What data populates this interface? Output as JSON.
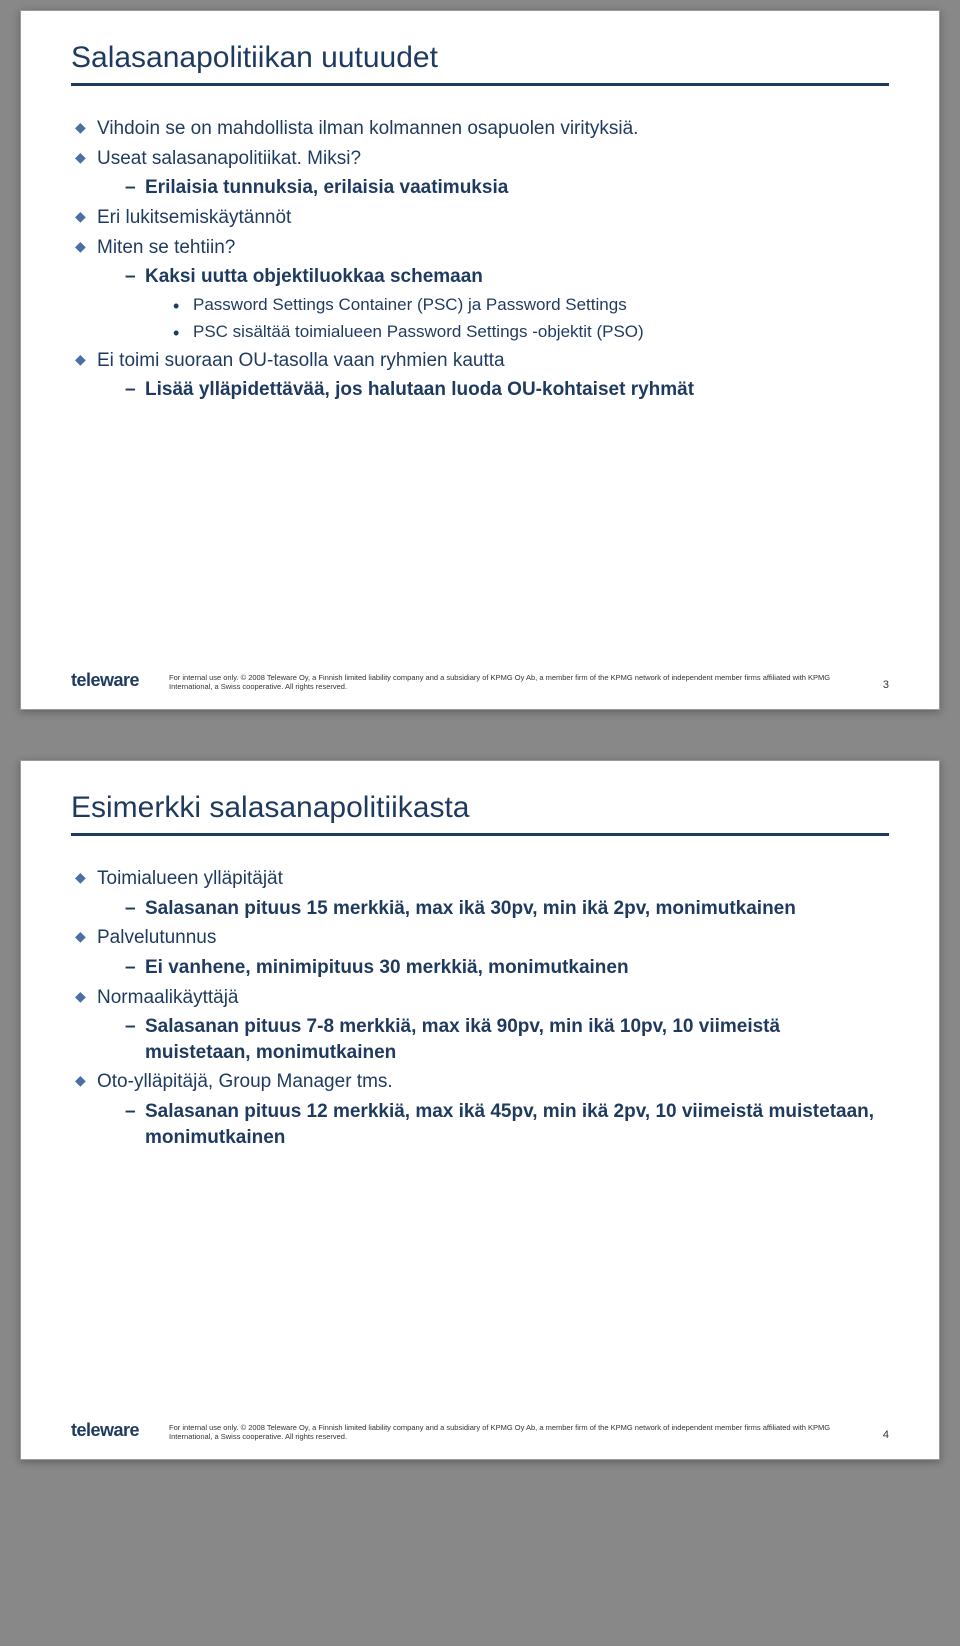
{
  "slides": [
    {
      "title": "Salasanapolitiikan uutuudet",
      "items": [
        {
          "text": "Vihdoin se on mahdollista ilman kolmannen osapuolen virityksiä."
        },
        {
          "text": "Useat salasanapolitiikat. Miksi?",
          "sub": [
            {
              "text": "Erilaisia tunnuksia, erilaisia vaatimuksia"
            }
          ]
        },
        {
          "text": "Eri lukitsemiskäytännöt"
        },
        {
          "text": "Miten se tehtiin?",
          "sub": [
            {
              "text": "Kaksi uutta objektiluokkaa schemaan",
              "sub": [
                {
                  "text": "Password Settings Container (PSC) ja Password Settings"
                },
                {
                  "text": "PSC sisältää toimialueen Password Settings -objektit (PSO)"
                }
              ]
            }
          ]
        },
        {
          "text": "Ei toimi suoraan OU-tasolla vaan ryhmien kautta",
          "sub": [
            {
              "text": "Lisää ylläpidettävää, jos halutaan luoda OU-kohtaiset ryhmät"
            }
          ]
        }
      ],
      "brand": "teleware",
      "legal": "For internal use only. © 2008 Teleware Oy, a Finnish limited liability company and a subsidiary of KPMG Oy Ab, a member firm of the KPMG network of independent member firms affiliated with KPMG International, a Swiss cooperative. All rights reserved.",
      "page": "3"
    },
    {
      "title": "Esimerkki salasanapolitiikasta",
      "items": [
        {
          "text": "Toimialueen ylläpitäjät",
          "sub": [
            {
              "text": "Salasanan pituus 15 merkkiä, max ikä 30pv, min ikä 2pv, monimutkainen"
            }
          ]
        },
        {
          "text": "Palvelutunnus",
          "sub": [
            {
              "text": "Ei vanhene, minimipituus 30 merkkiä, monimutkainen"
            }
          ]
        },
        {
          "text": "Normaalikäyttäjä",
          "sub": [
            {
              "text": "Salasanan pituus 7-8 merkkiä, max ikä 90pv, min ikä 10pv, 10 viimeistä muistetaan, monimutkainen"
            }
          ]
        },
        {
          "text": "Oto-ylläpitäjä, Group Manager tms.",
          "sub": [
            {
              "text": "Salasanan pituus 12 merkkiä, max ikä 45pv, min ikä 2pv, 10 viimeistä muistetaan, monimutkainen"
            }
          ]
        }
      ],
      "brand": "teleware",
      "legal": "For internal use only. © 2008 Teleware Oy, a Finnish limited liability company and a subsidiary of KPMG Oy Ab, a member firm of the KPMG network of independent member firms affiliated with KPMG International, a Swiss cooperative. All rights reserved.",
      "page": "4"
    }
  ]
}
